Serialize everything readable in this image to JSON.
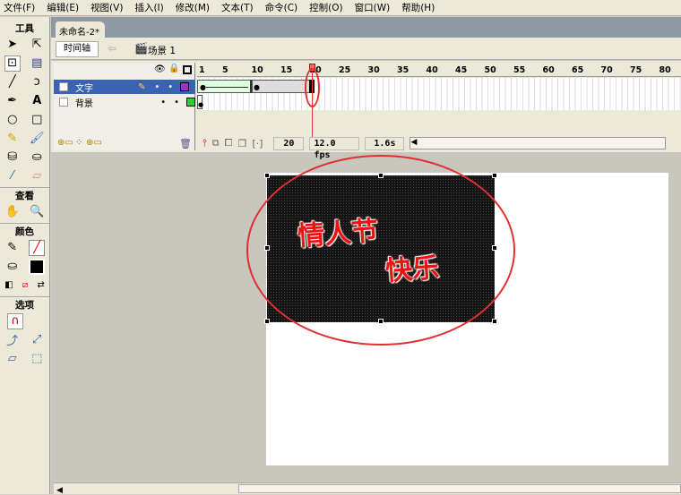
{
  "menu": [
    "文件(F)",
    "编辑(E)",
    "视图(V)",
    "插入(I)",
    "修改(M)",
    "文本(T)",
    "命令(C)",
    "控制(O)",
    "窗口(W)",
    "帮助(H)"
  ],
  "toolbox": {
    "tools_title": "工具",
    "view_title": "查看",
    "colors_title": "颜色",
    "options_title": "选项"
  },
  "document": {
    "tab": "未命名-2*",
    "timeline_button": "时间轴",
    "scene": "场景 1"
  },
  "timeline": {
    "layers": [
      {
        "name": "文字",
        "color": "#9933cc",
        "active": true
      },
      {
        "name": "背景",
        "color": "#33cc33",
        "active": false
      }
    ],
    "ruler_labels": [
      "1",
      "5",
      "10",
      "15",
      "20",
      "25",
      "30",
      "35",
      "40",
      "45",
      "50",
      "55",
      "60",
      "65",
      "70",
      "75",
      "80"
    ],
    "current_frame": "20",
    "frame_rate": "12.0 fps",
    "elapsed": "1.6s"
  },
  "stage": {
    "text_line1": "情人节",
    "text_line2": "快乐",
    "highlight_color": "#e03030"
  }
}
